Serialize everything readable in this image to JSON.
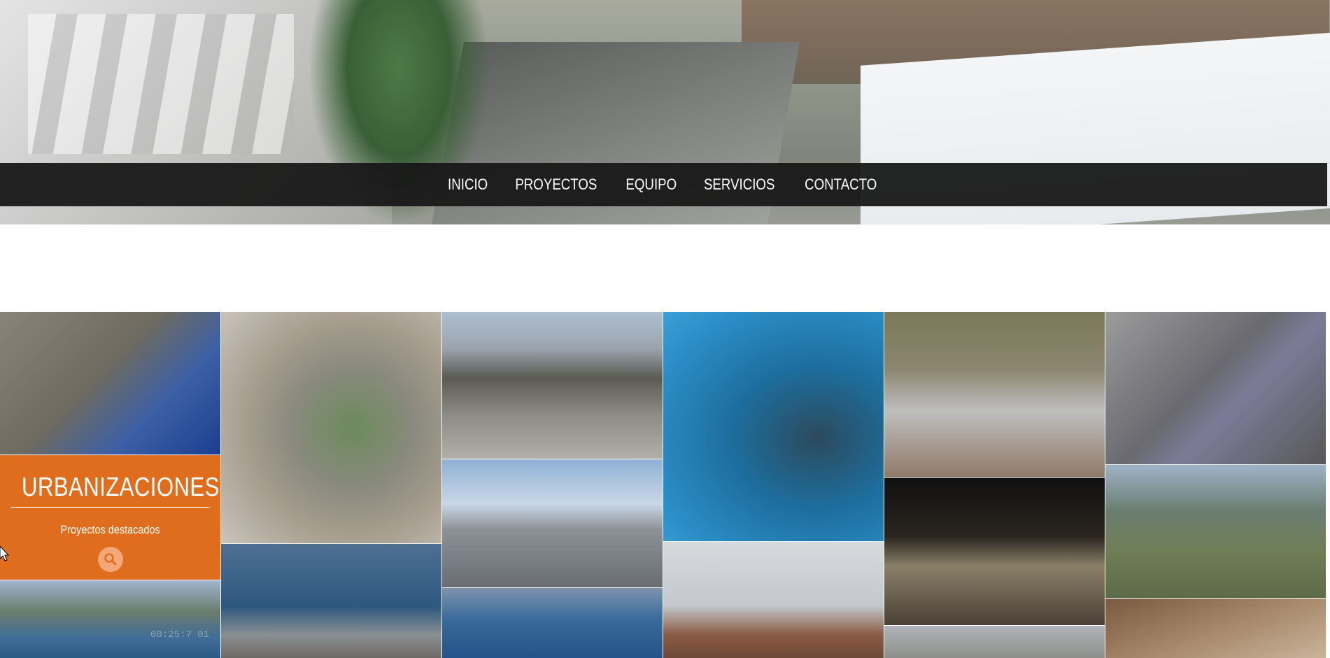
{
  "nav": {
    "items": [
      "INICIO",
      "PROYECTOS",
      "EQUIPO",
      "SERVICIOS",
      "CONTACTO"
    ]
  },
  "promo": {
    "title": "URBANIZACIONES",
    "subtitle": "Proyectos destacados",
    "icon": "search-icon",
    "background": "#e06d1d"
  },
  "photo_overlay": {
    "timestamp": "00:25:7 01"
  },
  "icons": {
    "cursor": "mouse-pointer-icon"
  }
}
